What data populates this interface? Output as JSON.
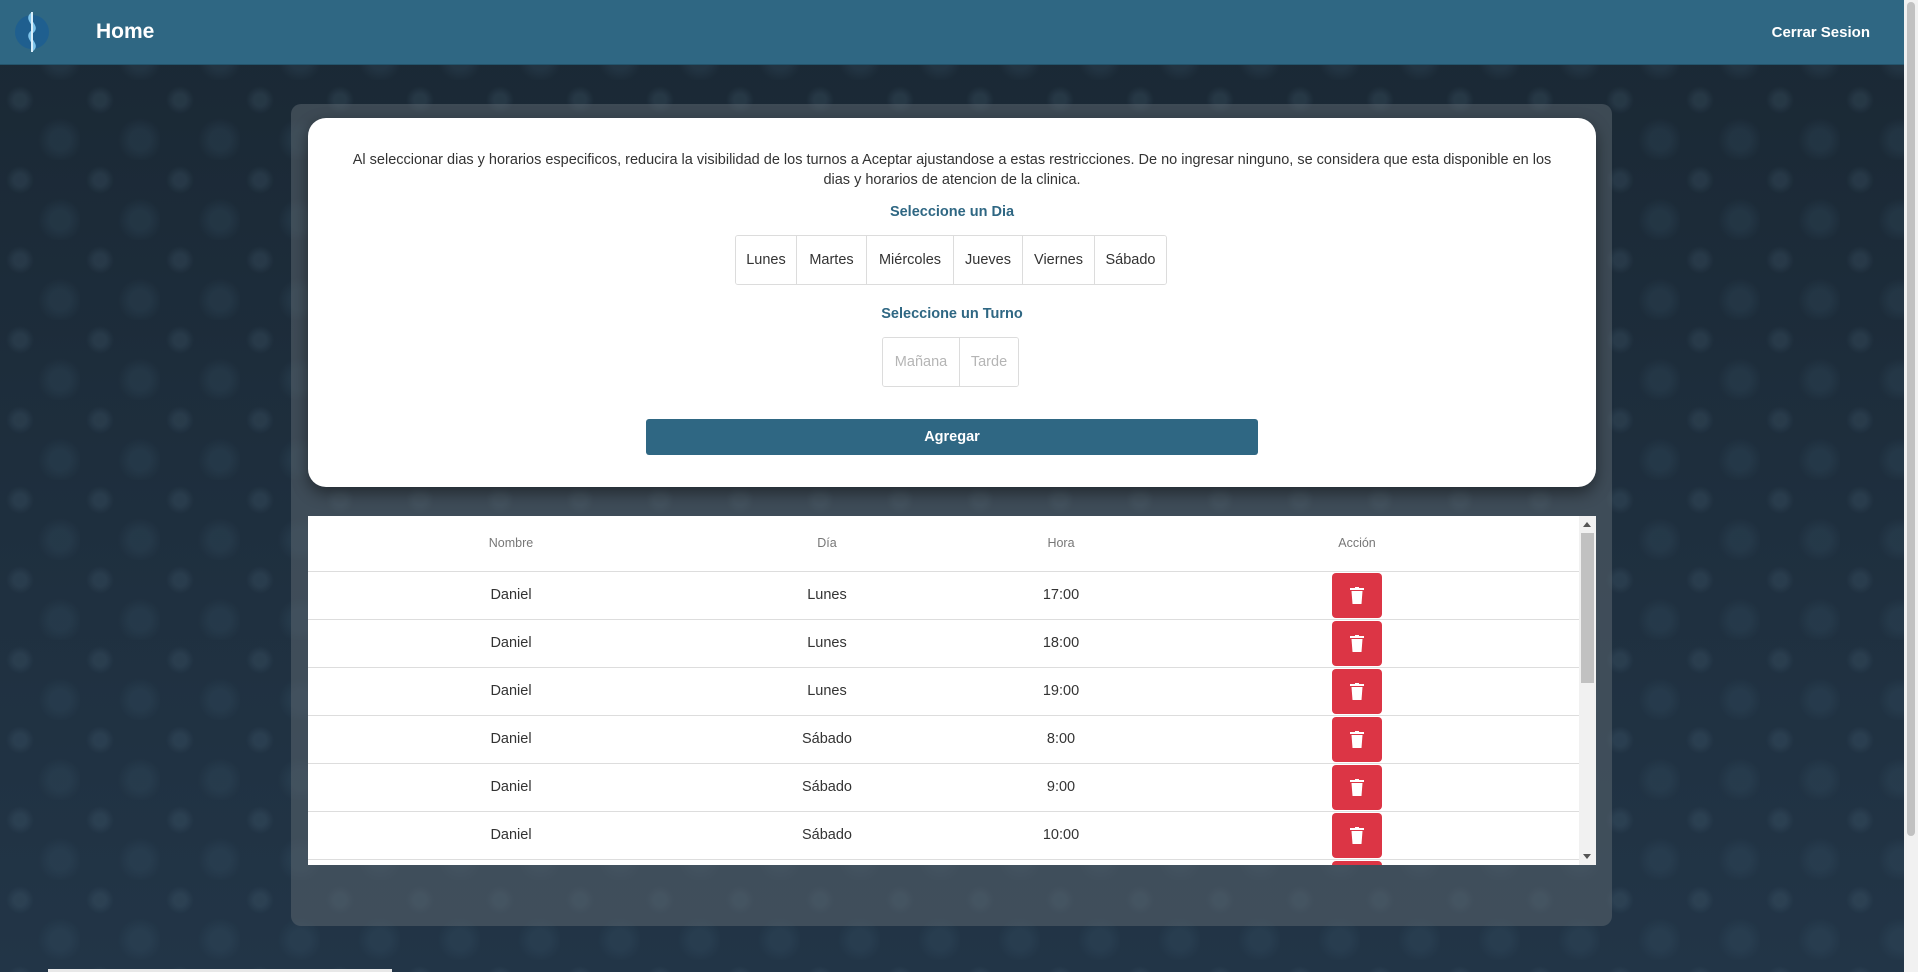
{
  "nav": {
    "title": "Home",
    "logout": "Cerrar Sesion"
  },
  "form": {
    "info": "Al seleccionar dias y horarios especificos, reducira la visibilidad de los turnos a Aceptar ajustandose a estas restricciones. De no ingresar ninguno, se considera que esta disponible en los dias y horarios de atencion de la clinica.",
    "day_label": "Seleccione un Dia",
    "days": [
      "Lunes",
      "Martes",
      "Miércoles",
      "Jueves",
      "Viernes",
      "Sábado"
    ],
    "shift_label": "Seleccione un Turno",
    "shifts": [
      "Mañana",
      "Tarde"
    ],
    "submit": "Agregar"
  },
  "table": {
    "headers": [
      "Nombre",
      "Día",
      "Hora",
      "Acción"
    ],
    "rows": [
      {
        "nombre": "Daniel",
        "dia": "Lunes",
        "hora": "17:00"
      },
      {
        "nombre": "Daniel",
        "dia": "Lunes",
        "hora": "18:00"
      },
      {
        "nombre": "Daniel",
        "dia": "Lunes",
        "hora": "19:00"
      },
      {
        "nombre": "Daniel",
        "dia": "Sábado",
        "hora": "8:00"
      },
      {
        "nombre": "Daniel",
        "dia": "Sábado",
        "hora": "9:00"
      },
      {
        "nombre": "Daniel",
        "dia": "Sábado",
        "hora": "10:00"
      }
    ],
    "delete_icon": "trash-icon"
  },
  "colors": {
    "primary": "#2f6783",
    "danger": "#dc3545"
  }
}
